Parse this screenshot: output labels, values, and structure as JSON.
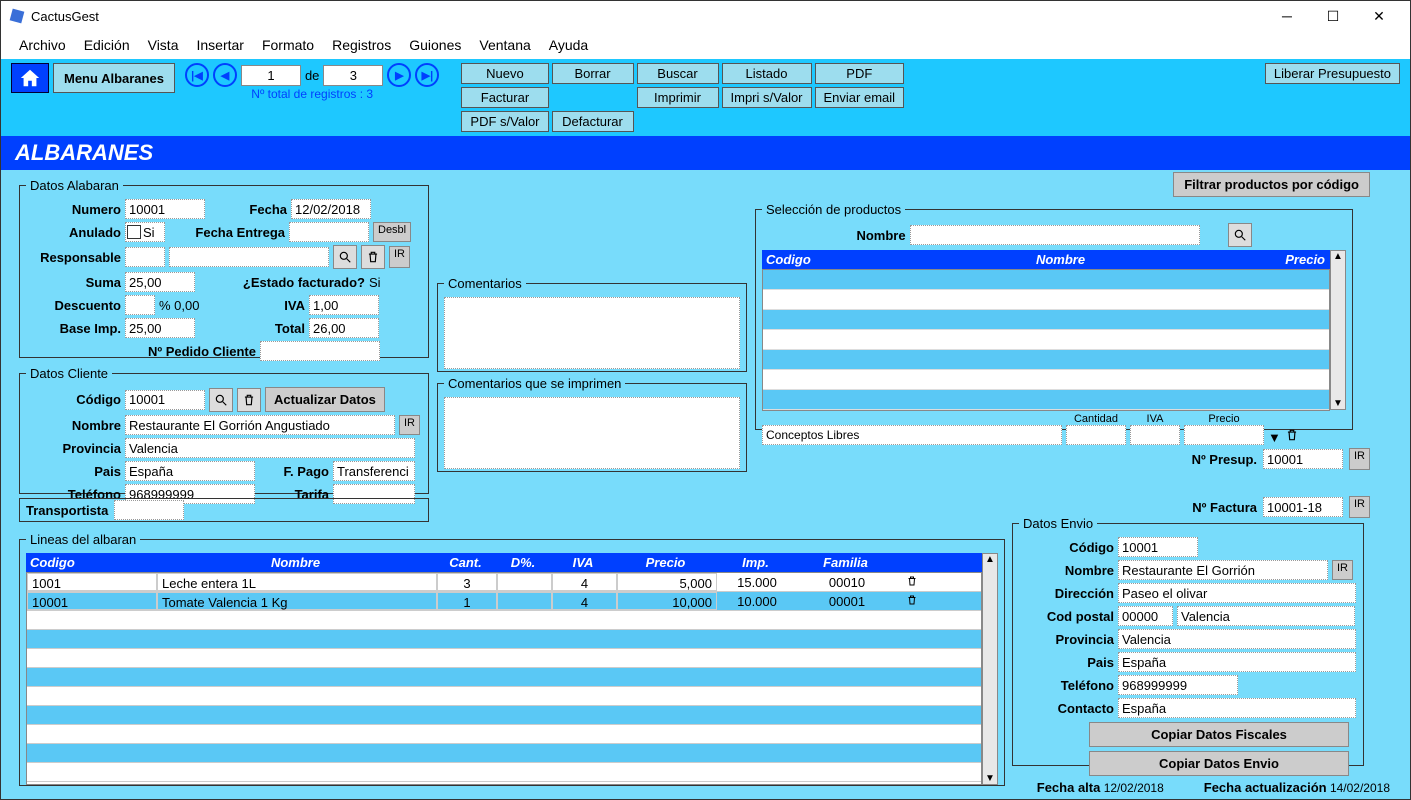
{
  "app": {
    "title": "CactusGest"
  },
  "menu": [
    "Archivo",
    "Edición",
    "Vista",
    "Insertar",
    "Formato",
    "Registros",
    "Guiones",
    "Ventana",
    "Ayuda"
  ],
  "toolbar": {
    "menuAlb": "Menu Albaranes",
    "recCurrent": "1",
    "recOf": "de",
    "recTotal": "3",
    "recLabel": "Nº total de registros : 3",
    "buttons": {
      "nuevo": "Nuevo",
      "borrar": "Borrar",
      "buscar": "Buscar",
      "listado": "Listado",
      "pdf": "PDF",
      "facturar": "Facturar",
      "imprimir": "Imprimir",
      "impriSValor": "Impri s/Valor",
      "enviarEmail": "Enviar email",
      "pdfSValor": "PDF s/Valor",
      "defacturar": "Defacturar",
      "liberar": "Liberar Presupuesto"
    }
  },
  "header": "ALBARANES",
  "filterBtn": "Filtrar productos por código",
  "alabaran": {
    "legend": "Datos Alabaran",
    "numeroLbl": "Numero",
    "numero": "10001",
    "fechaLbl": "Fecha",
    "fecha": "12/02/2018",
    "anuladoLbl": "Anulado",
    "si": "Si",
    "fechaEntregaLbl": "Fecha Entrega",
    "fechaEntrega": "",
    "desbl": "Desbl",
    "responsableLbl": "Responsable",
    "responsable": "",
    "ir": "IR",
    "sumaLbl": "Suma",
    "suma": "25,00",
    "facturadoLbl": "¿Estado facturado?",
    "facturado": "Si",
    "descuentoLbl": "Descuento",
    "descuento": "",
    "pct": "% 0,00",
    "ivaLbl": "IVA",
    "iva": "1,00",
    "baseLbl": "Base Imp.",
    "base": "25,00",
    "totalLbl": "Total",
    "total": "26,00",
    "pedidoLbl": "Nº Pedido Cliente",
    "pedido": ""
  },
  "cliente": {
    "legend": "Datos Cliente",
    "codigoLbl": "Código",
    "codigo": "10001",
    "actualizar": "Actualizar Datos",
    "nombreLbl": "Nombre",
    "nombre": "Restaurante El  Gorrión Angustiado",
    "provinciaLbl": "Provincia",
    "provincia": "Valencia",
    "paisLbl": "Pais",
    "pais": "España",
    "fpagoLbl": "F. Pago",
    "fpago": "Transferenci",
    "telefonoLbl": "Teléfono",
    "telefono": "968999999",
    "tarifaLbl": "Tarifa",
    "tarifa": "",
    "ir": "IR"
  },
  "transportista": {
    "label": "Transportista",
    "value": ""
  },
  "comentarios": {
    "legend": "Comentarios"
  },
  "comentariosImpr": {
    "legend": "Comentarios que se imprimen"
  },
  "productos": {
    "legend": "Selección de productos",
    "nombreLbl": "Nombre",
    "nombre": "",
    "hdr": {
      "codigo": "Codigo",
      "nombre": "Nombre",
      "precio": "Precio"
    },
    "conceptos": "Conceptos Libres",
    "cantidad": "Cantidad",
    "iva": "IVA",
    "precio": "Precio"
  },
  "presup": {
    "label": "Nº Presup.",
    "value": "10001",
    "ir": "IR"
  },
  "factura": {
    "label": "Nº Factura",
    "value": "10001-18",
    "ir": "IR"
  },
  "lineas": {
    "legend": "Lineas del albaran",
    "hdr": {
      "codigo": "Codigo",
      "nombre": "Nombre",
      "cant": "Cant.",
      "dpct": "D%.",
      "iva": "IVA",
      "precio": "Precio",
      "imp": "Imp.",
      "familia": "Familia"
    },
    "rows": [
      {
        "codigo": "1001",
        "nombre": "Leche entera 1L",
        "cant": "3",
        "dpct": "",
        "iva": "4",
        "precio": "5,000",
        "imp": "15.000",
        "familia": "00010"
      },
      {
        "codigo": "10001",
        "nombre": "Tomate Valencia 1 Kg",
        "cant": "1",
        "dpct": "",
        "iva": "4",
        "precio": "10,000",
        "imp": "10.000",
        "familia": "00001"
      }
    ]
  },
  "envio": {
    "legend": "Datos Envio",
    "codigoLbl": "Código",
    "codigo": "10001",
    "nombreLbl": "Nombre",
    "nombre": "Restaurante El  Gorrión",
    "direccionLbl": "Dirección",
    "direccion": "Paseo el olivar",
    "cpLbl": "Cod postal",
    "cp": "00000",
    "cpCity": "Valencia",
    "provinciaLbl": "Provincia",
    "provincia": "Valencia",
    "paisLbl": "Pais",
    "pais": "España",
    "telefonoLbl": "Teléfono",
    "telefono": "968999999",
    "contactoLbl": "Contacto",
    "contacto": "España",
    "ir": "IR",
    "copFisc": "Copiar Datos Fiscales",
    "copEnv": "Copiar Datos Envio"
  },
  "footer": {
    "altaLbl": "Fecha alta",
    "alta": "12/02/2018",
    "actLbl": "Fecha actualización",
    "act": "14/02/2018"
  }
}
